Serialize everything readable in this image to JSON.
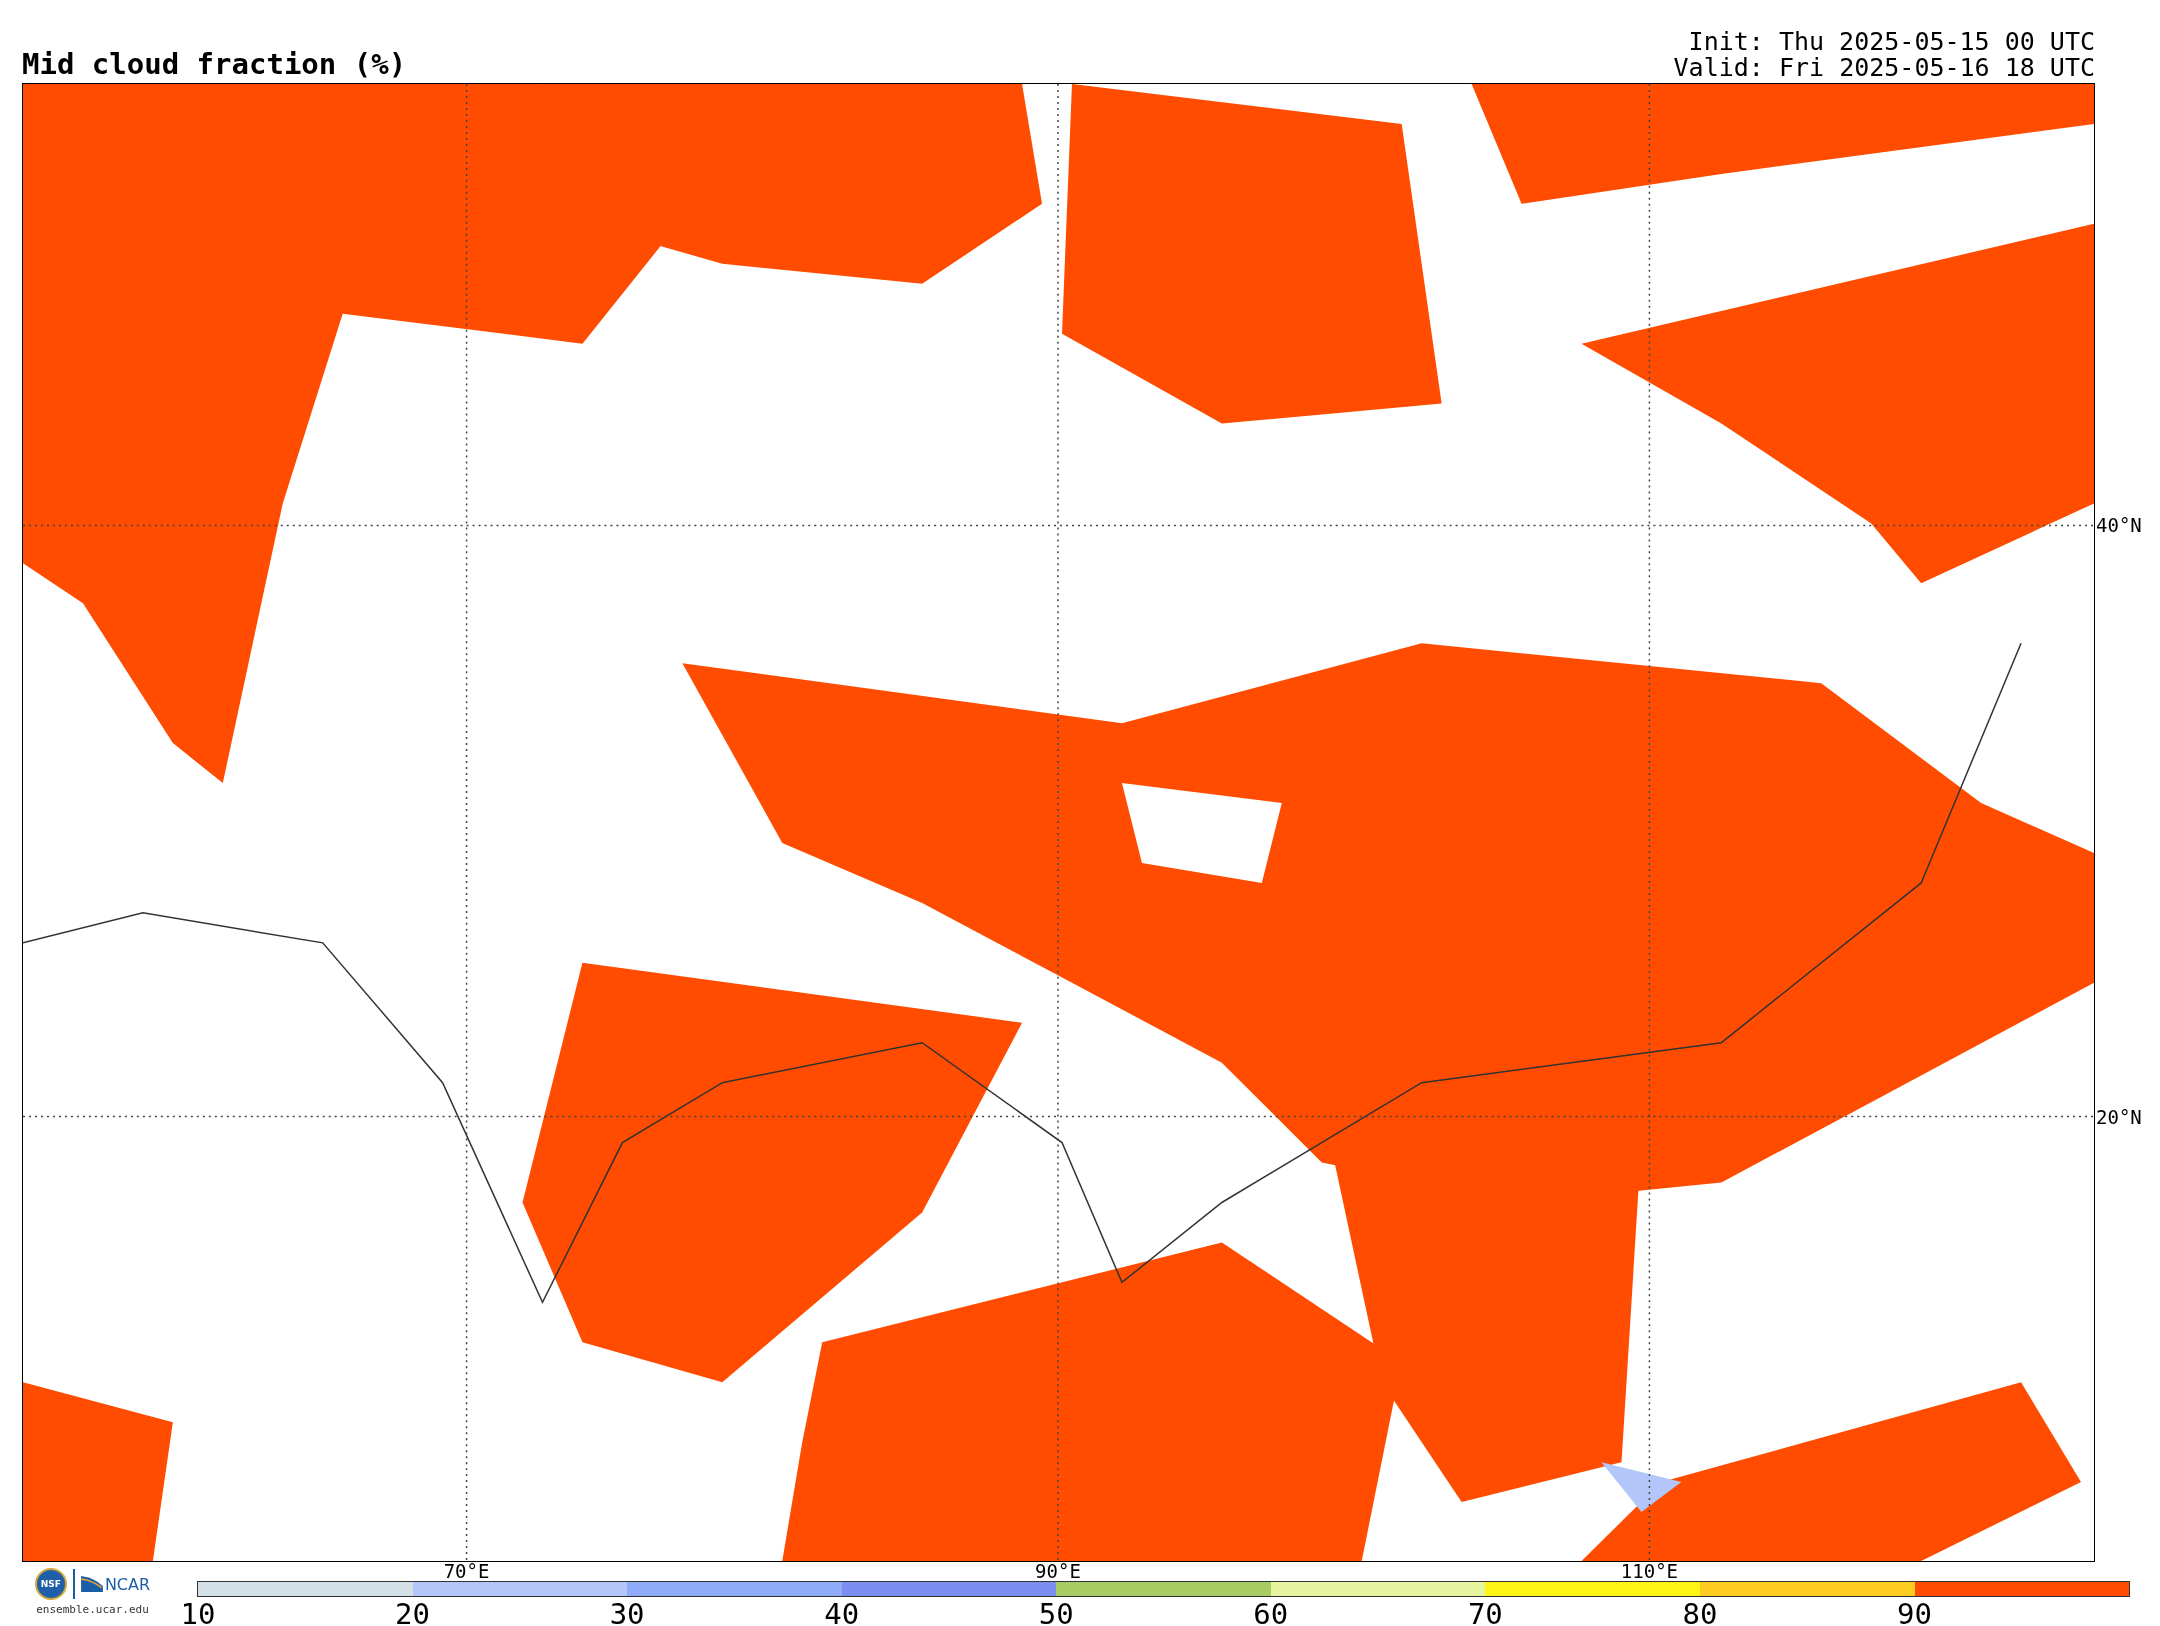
{
  "title": "Mid cloud fraction (%)",
  "init": "Init: Thu 2025-05-15 00 UTC",
  "valid": "Valid: Fri 2025-05-16 18 UTC",
  "map": {
    "lon_labels": [
      "70°E",
      "90°E",
      "110°E"
    ],
    "lat_labels": [
      "40°N",
      "20°N"
    ]
  },
  "logos": {
    "nsf": "NSF",
    "ncar": "NCAR",
    "url": "ensemble.ucar.edu"
  },
  "colorbar": {
    "segments": [
      {
        "tick": "10",
        "color": "#d4e0e8"
      },
      {
        "tick": "20",
        "color": "#b3c6fa"
      },
      {
        "tick": "30",
        "color": "#8eacf8"
      },
      {
        "tick": "40",
        "color": "#7c8ef2"
      },
      {
        "tick": "50",
        "color": "#a8cc64"
      },
      {
        "tick": "60",
        "color": "#e6f4a0"
      },
      {
        "tick": "70",
        "color": "#fff514"
      },
      {
        "tick": "80",
        "color": "#ffcc22"
      },
      {
        "tick": "90",
        "color": "#ff4c00"
      }
    ]
  }
}
